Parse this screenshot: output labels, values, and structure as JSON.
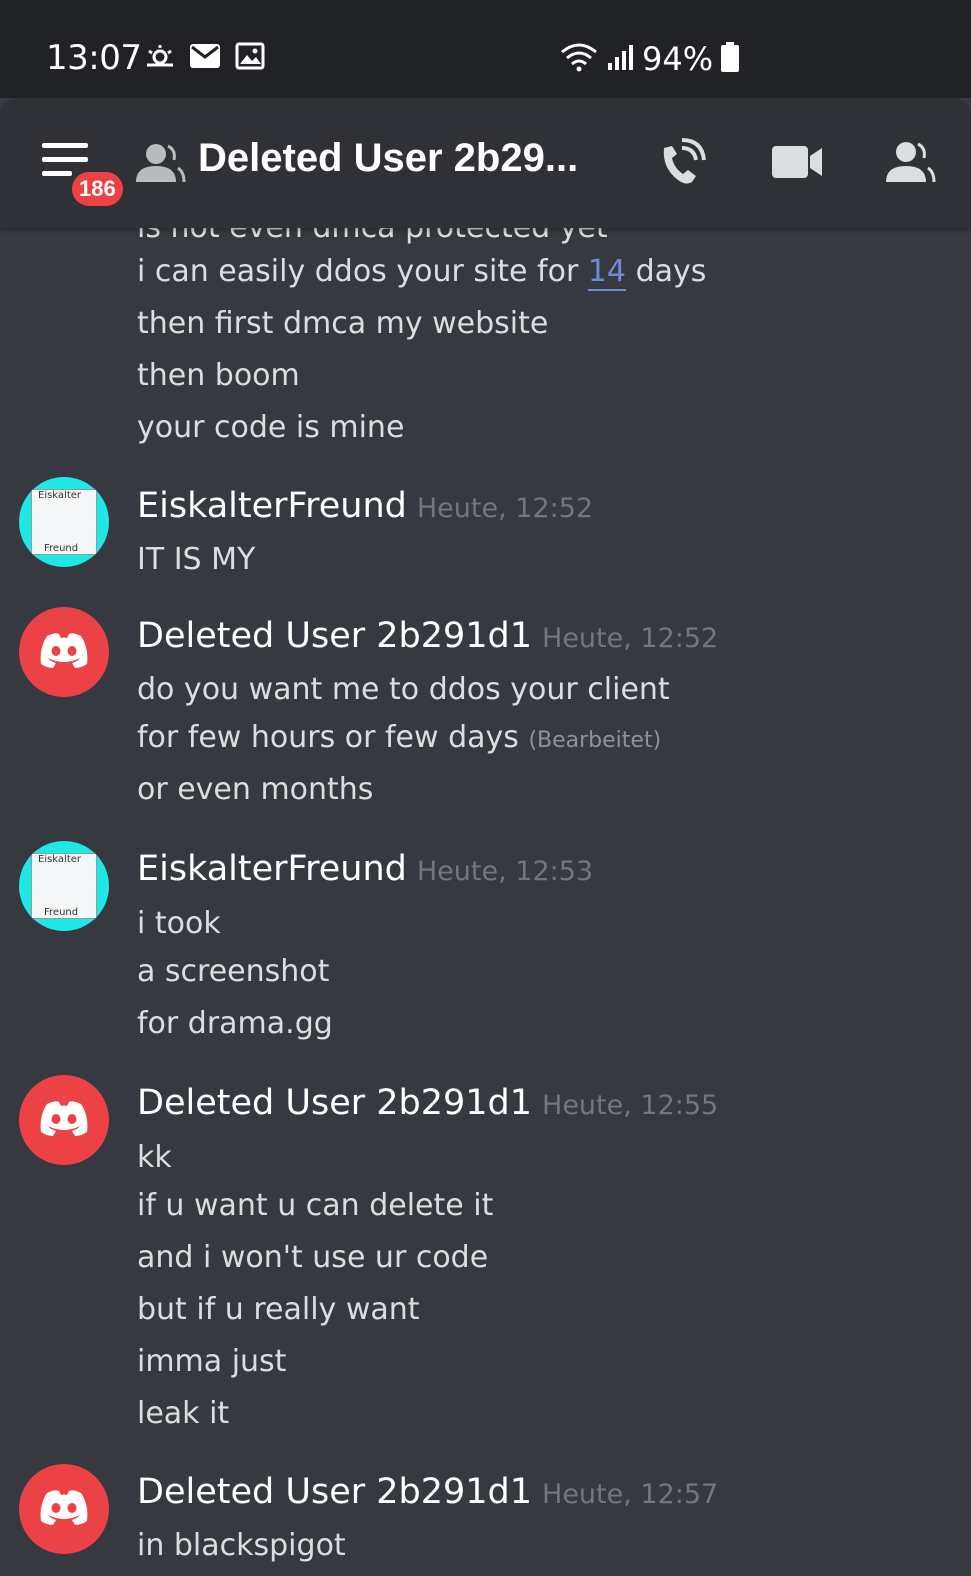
{
  "status_bar": {
    "time": "13:07",
    "battery": "94%",
    "icons_left": [
      "weather-icon",
      "mail-icon",
      "image-icon"
    ],
    "icons_right": [
      "wifi-icon",
      "signal-icon",
      "battery-icon"
    ]
  },
  "header": {
    "title": "Deleted User 2b29...",
    "unread_badge": "186",
    "accent_color": "#ed4245"
  },
  "messages": [
    {
      "lines": [
        "is not even dmca protected yet"
      ],
      "continuation": true
    },
    {
      "line_parts": [
        "i can easily ddos your site for ",
        "14",
        " days"
      ]
    },
    {
      "text": "then first dmca my website"
    },
    {
      "text": "then boom"
    },
    {
      "text": "your code is mine"
    }
  ],
  "groups": [
    {
      "author": "EiskalterFreund",
      "timestamp": "Heute, 12:52",
      "avatar": "eiskalter-avatar",
      "avatar_text_top": "Eiskalter",
      "avatar_text_bottom": "Freund",
      "lines": [
        "IT IS MY"
      ]
    },
    {
      "author": "Deleted User 2b291d1",
      "timestamp": "Heute, 12:52",
      "avatar": "discord-avatar",
      "lines": [
        "do you want me to ddos your client",
        "for few hours or few days",
        "or even months"
      ],
      "edited_label": "(Bearbeitet)"
    },
    {
      "author": "EiskalterFreund",
      "timestamp": "Heute, 12:53",
      "avatar": "eiskalter-avatar",
      "avatar_text_top": "Eiskalter",
      "avatar_text_bottom": "Freund",
      "lines": [
        "i took",
        "a screenshot",
        "for drama.gg"
      ]
    },
    {
      "author": "Deleted User 2b291d1",
      "timestamp": "Heute, 12:55",
      "avatar": "discord-avatar",
      "lines": [
        "kk",
        "if u want u can delete it",
        "and i won't use ur code",
        "but if u really want",
        "imma just",
        "leak it"
      ]
    },
    {
      "author": "Deleted User 2b291d1",
      "timestamp": "Heute, 12:57",
      "avatar": "discord-avatar",
      "lines": [
        "in blackspigot"
      ]
    }
  ]
}
